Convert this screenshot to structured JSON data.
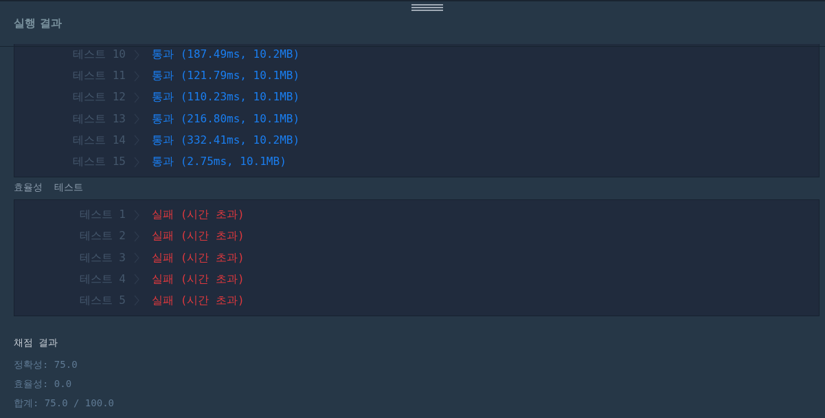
{
  "header": {
    "title": "실행 결과"
  },
  "sections": [
    {
      "tests": [
        {
          "label": "테스트 10",
          "kind": "pass",
          "result": "통과 (187.49ms, 10.2MB)"
        },
        {
          "label": "테스트 11",
          "kind": "pass",
          "result": "통과 (121.79ms, 10.1MB)"
        },
        {
          "label": "테스트 12",
          "kind": "pass",
          "result": "통과 (110.23ms, 10.1MB)"
        },
        {
          "label": "테스트 13",
          "kind": "pass",
          "result": "통과 (216.80ms, 10.1MB)"
        },
        {
          "label": "테스트 14",
          "kind": "pass",
          "result": "통과 (332.41ms, 10.2MB)"
        },
        {
          "label": "테스트 15",
          "kind": "pass",
          "result": "통과 (2.75ms, 10.1MB)"
        }
      ]
    },
    {
      "heading": "효율성  테스트",
      "tests": [
        {
          "label": "테스트 1",
          "kind": "fail",
          "result": "실패 (시간 초과)"
        },
        {
          "label": "테스트 2",
          "kind": "fail",
          "result": "실패 (시간 초과)"
        },
        {
          "label": "테스트 3",
          "kind": "fail",
          "result": "실패 (시간 초과)"
        },
        {
          "label": "테스트 4",
          "kind": "fail",
          "result": "실패 (시간 초과)"
        },
        {
          "label": "테스트 5",
          "kind": "fail",
          "result": "실패 (시간 초과)"
        }
      ]
    }
  ],
  "score": {
    "title": "채점 결과",
    "lines": [
      "정확성: 75.0",
      "효율성: 0.0",
      "합계: 75.0 / 100.0"
    ]
  }
}
